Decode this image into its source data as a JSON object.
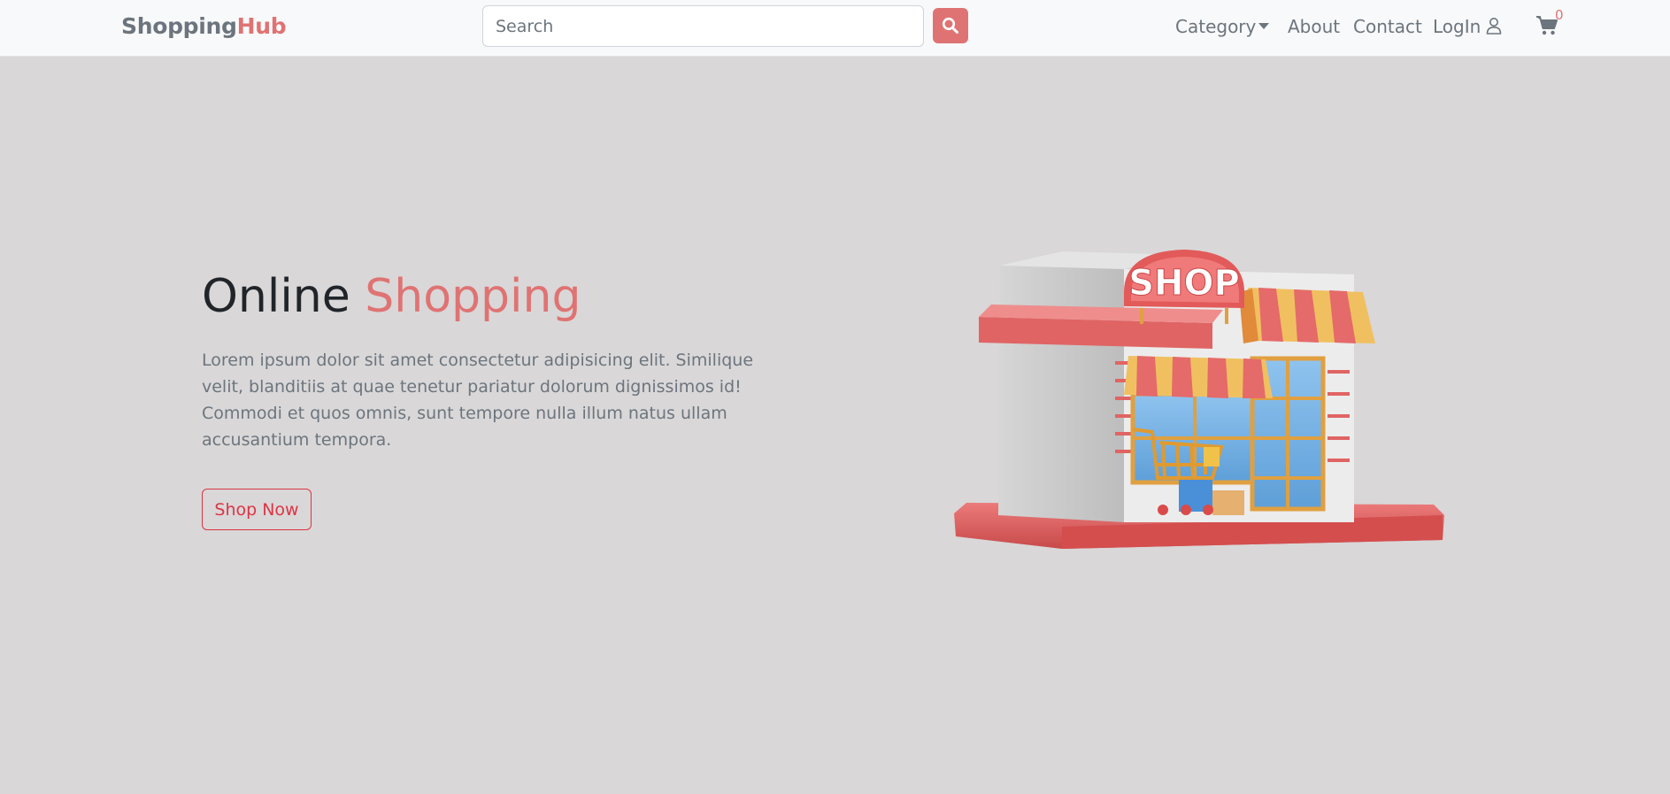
{
  "brand": {
    "part1": "Shopping",
    "part2": "Hub"
  },
  "search": {
    "placeholder": "Search",
    "button_icon": "search-icon"
  },
  "nav": {
    "category": "Category",
    "about": "About",
    "contact": "Contact",
    "login": "LogIn",
    "login_icon": "user-icon",
    "cart_icon": "cart-icon",
    "cart_count": "0"
  },
  "hero": {
    "title_part1": "Online ",
    "title_part2": "Shopping",
    "text": "Lorem ipsum dolor sit amet consectetur adipisicing elit. Similique velit, blanditiis at quae tenetur pariatur dolorum dignissimos id! Commodi et quos omnis, sunt tempore nulla illum natus ullam accusantium tempora.",
    "button": "Shop Now",
    "image_sign": "SHOP"
  },
  "colors": {
    "accent": "#df7373",
    "muted": "#6c757d",
    "danger": "#dc3545",
    "background": "#d9d7d8",
    "navbar": "#f8f9fa"
  }
}
